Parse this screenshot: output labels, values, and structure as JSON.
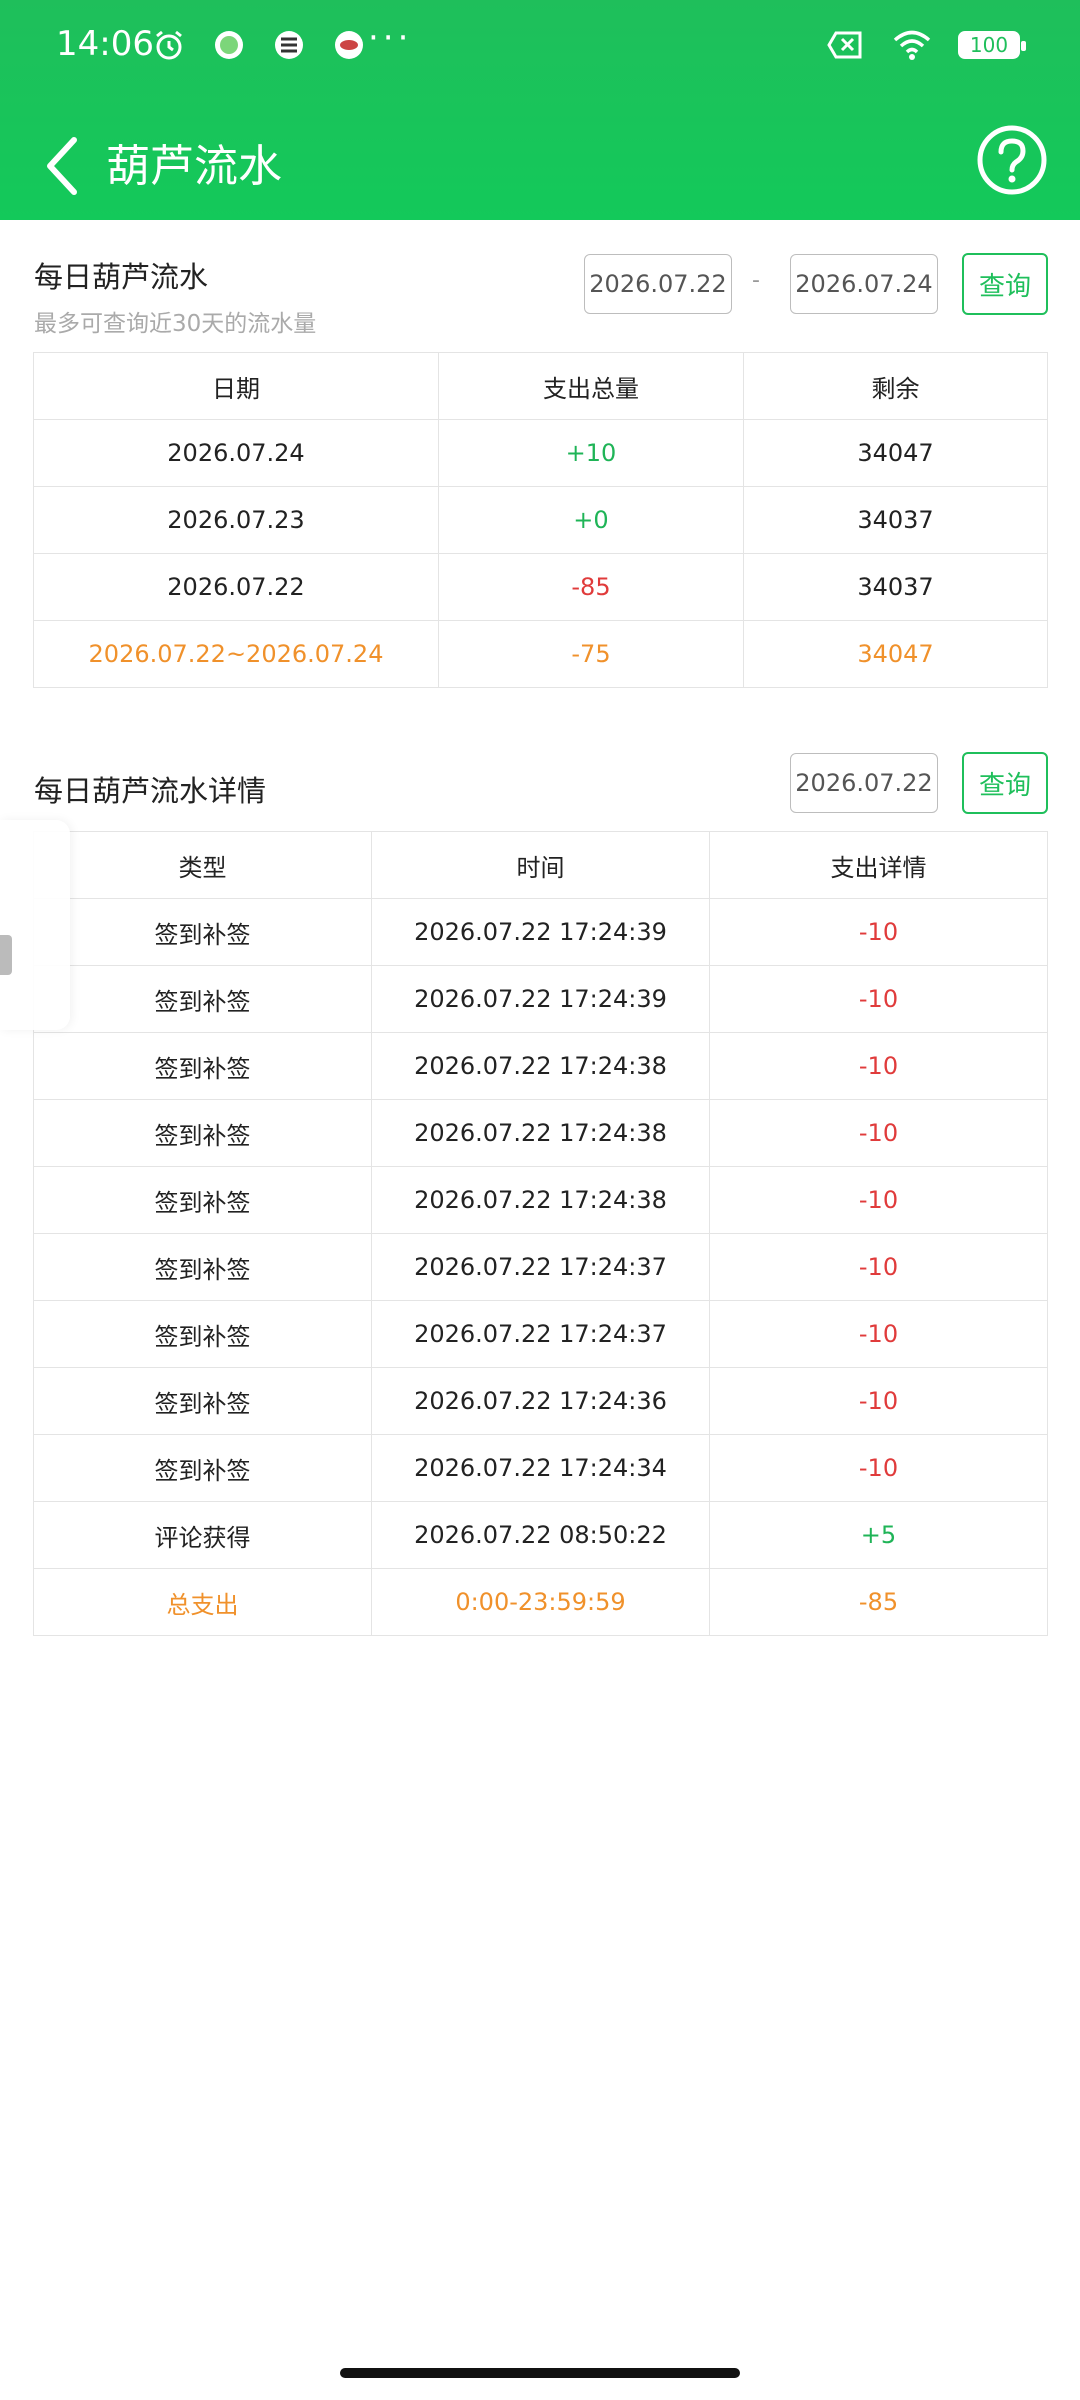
{
  "status_bar": {
    "time": "14:06",
    "battery": "100",
    "ellipsis": "···",
    "icons": [
      "alarm-icon",
      "app-notification-icon",
      "app-notification-icon",
      "app-notification-icon",
      "sim-off-icon",
      "wifi-icon",
      "battery-icon"
    ]
  },
  "app_bar": {
    "title": "葫芦流水",
    "back_icon": "chevron-left-icon",
    "help_icon": "question-circle-icon"
  },
  "daily_flow": {
    "title": "每日葫芦流水",
    "hint": "最多可查询近30天的流水量",
    "start_date": "2026.07.22",
    "separator": "-",
    "end_date": "2026.07.24",
    "query_label": "查询",
    "columns": [
      "日期",
      "支出总量",
      "剩余"
    ],
    "rows": [
      {
        "date": "2026.07.24",
        "amount": "+10",
        "remaining": "34047"
      },
      {
        "date": "2026.07.23",
        "amount": "+0",
        "remaining": "34037"
      },
      {
        "date": "2026.07.22",
        "amount": "-85",
        "remaining": "34037"
      }
    ],
    "total": {
      "date": "2026.07.22~2026.07.24",
      "amount": "-75",
      "remaining": "34047"
    }
  },
  "detail_flow": {
    "title": "每日葫芦流水详情",
    "date": "2026.07.22",
    "query_label": "查询",
    "columns": [
      "类型",
      "时间",
      "支出详情"
    ],
    "rows": [
      {
        "type": "签到补签",
        "time": "2026.07.22 17:24:39",
        "amount": "-10"
      },
      {
        "type": "签到补签",
        "time": "2026.07.22 17:24:39",
        "amount": "-10"
      },
      {
        "type": "签到补签",
        "time": "2026.07.22 17:24:38",
        "amount": "-10"
      },
      {
        "type": "签到补签",
        "time": "2026.07.22 17:24:38",
        "amount": "-10"
      },
      {
        "type": "签到补签",
        "time": "2026.07.22 17:24:38",
        "amount": "-10"
      },
      {
        "type": "签到补签",
        "time": "2026.07.22 17:24:37",
        "amount": "-10"
      },
      {
        "type": "签到补签",
        "time": "2026.07.22 17:24:37",
        "amount": "-10"
      },
      {
        "type": "签到补签",
        "time": "2026.07.22 17:24:36",
        "amount": "-10"
      },
      {
        "type": "签到补签",
        "time": "2026.07.22 17:24:34",
        "amount": "-10"
      },
      {
        "type": "评论获得",
        "time": "2026.07.22 08:50:22",
        "amount": "+5"
      }
    ],
    "total": {
      "type": "总支出",
      "time": "0:00-23:59:59",
      "amount": "-85"
    }
  },
  "colors": {
    "brand_green": "#1fbf5b",
    "positive": "#1fb457",
    "negative": "#e03b3b",
    "total": "#f0912b"
  }
}
